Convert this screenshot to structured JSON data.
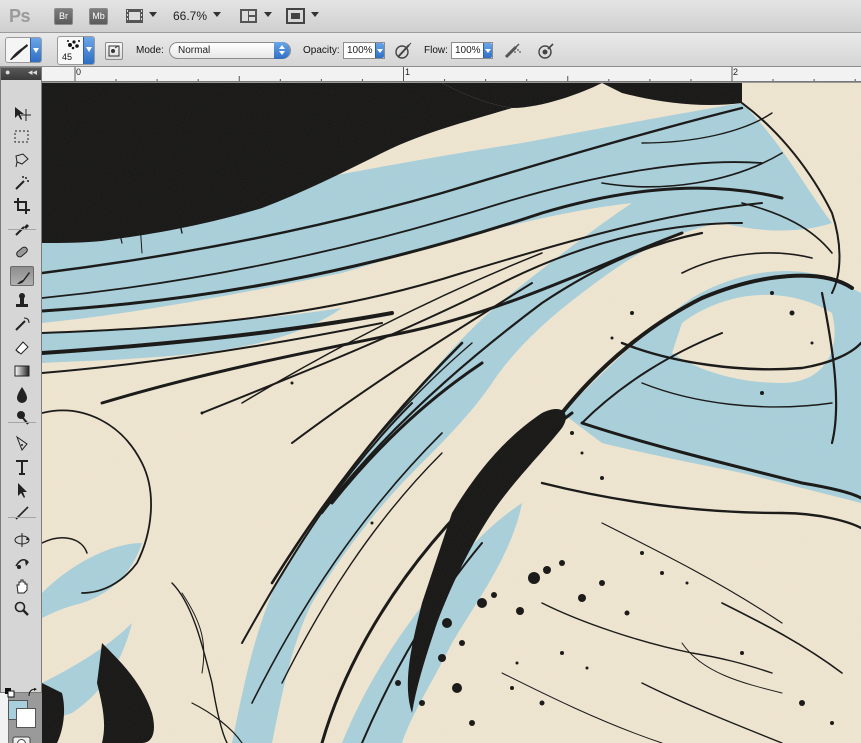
{
  "app": {
    "logo": "Ps",
    "bridge_label": "Br",
    "minibridge_label": "Mb",
    "zoom_level": "66.7%"
  },
  "options": {
    "brush_size": "45",
    "mode_label": "Mode:",
    "mode_value": "Normal",
    "opacity_label": "Opacity:",
    "opacity_value": "100%",
    "flow_label": "Flow:",
    "flow_value": "100%"
  },
  "rulers": {
    "top": [
      "0",
      "1",
      "2"
    ]
  },
  "tools": [
    {
      "name": "move-tool-icon",
      "glyph": "move",
      "active": false
    },
    {
      "name": "marquee-tool-icon",
      "glyph": "marquee",
      "active": false
    },
    {
      "name": "lasso-tool-icon",
      "glyph": "lasso",
      "active": false
    },
    {
      "name": "magic-wand-tool-icon",
      "glyph": "wand",
      "active": false
    },
    {
      "name": "crop-tool-icon",
      "glyph": "crop",
      "active": false
    },
    {
      "name": "eyedropper-tool-icon",
      "glyph": "eyedropper",
      "active": false
    },
    {
      "name": "healing-brush-tool-icon",
      "glyph": "heal",
      "active": false
    },
    {
      "name": "brush-tool-icon",
      "glyph": "brush",
      "active": true
    },
    {
      "name": "clone-stamp-tool-icon",
      "glyph": "stamp",
      "active": false
    },
    {
      "name": "history-brush-tool-icon",
      "glyph": "history",
      "active": false
    },
    {
      "name": "eraser-tool-icon",
      "glyph": "eraser",
      "active": false
    },
    {
      "name": "gradient-tool-icon",
      "glyph": "gradient",
      "active": false
    },
    {
      "name": "blur-tool-icon",
      "glyph": "blur",
      "active": false
    },
    {
      "name": "dodge-tool-icon",
      "glyph": "dodge",
      "active": false
    },
    {
      "name": "pen-tool-icon",
      "glyph": "pen",
      "active": false
    },
    {
      "name": "type-tool-icon",
      "glyph": "type",
      "active": false
    },
    {
      "name": "path-selection-tool-icon",
      "glyph": "arrow",
      "active": false
    },
    {
      "name": "line-tool-icon",
      "glyph": "line",
      "active": false
    },
    {
      "name": "3d-rotate-tool-icon",
      "glyph": "rotate3d",
      "active": false
    },
    {
      "name": "3d-orbit-tool-icon",
      "glyph": "orbit",
      "active": false
    },
    {
      "name": "hand-tool-icon",
      "glyph": "hand",
      "active": false
    },
    {
      "name": "zoom-tool-icon",
      "glyph": "zoom",
      "active": false
    }
  ],
  "colors": {
    "foreground": "#a8d0dc",
    "background": "#ffffff",
    "paper": "#efe6d2",
    "ink": "#141414",
    "wash": "#a8d0dc"
  }
}
